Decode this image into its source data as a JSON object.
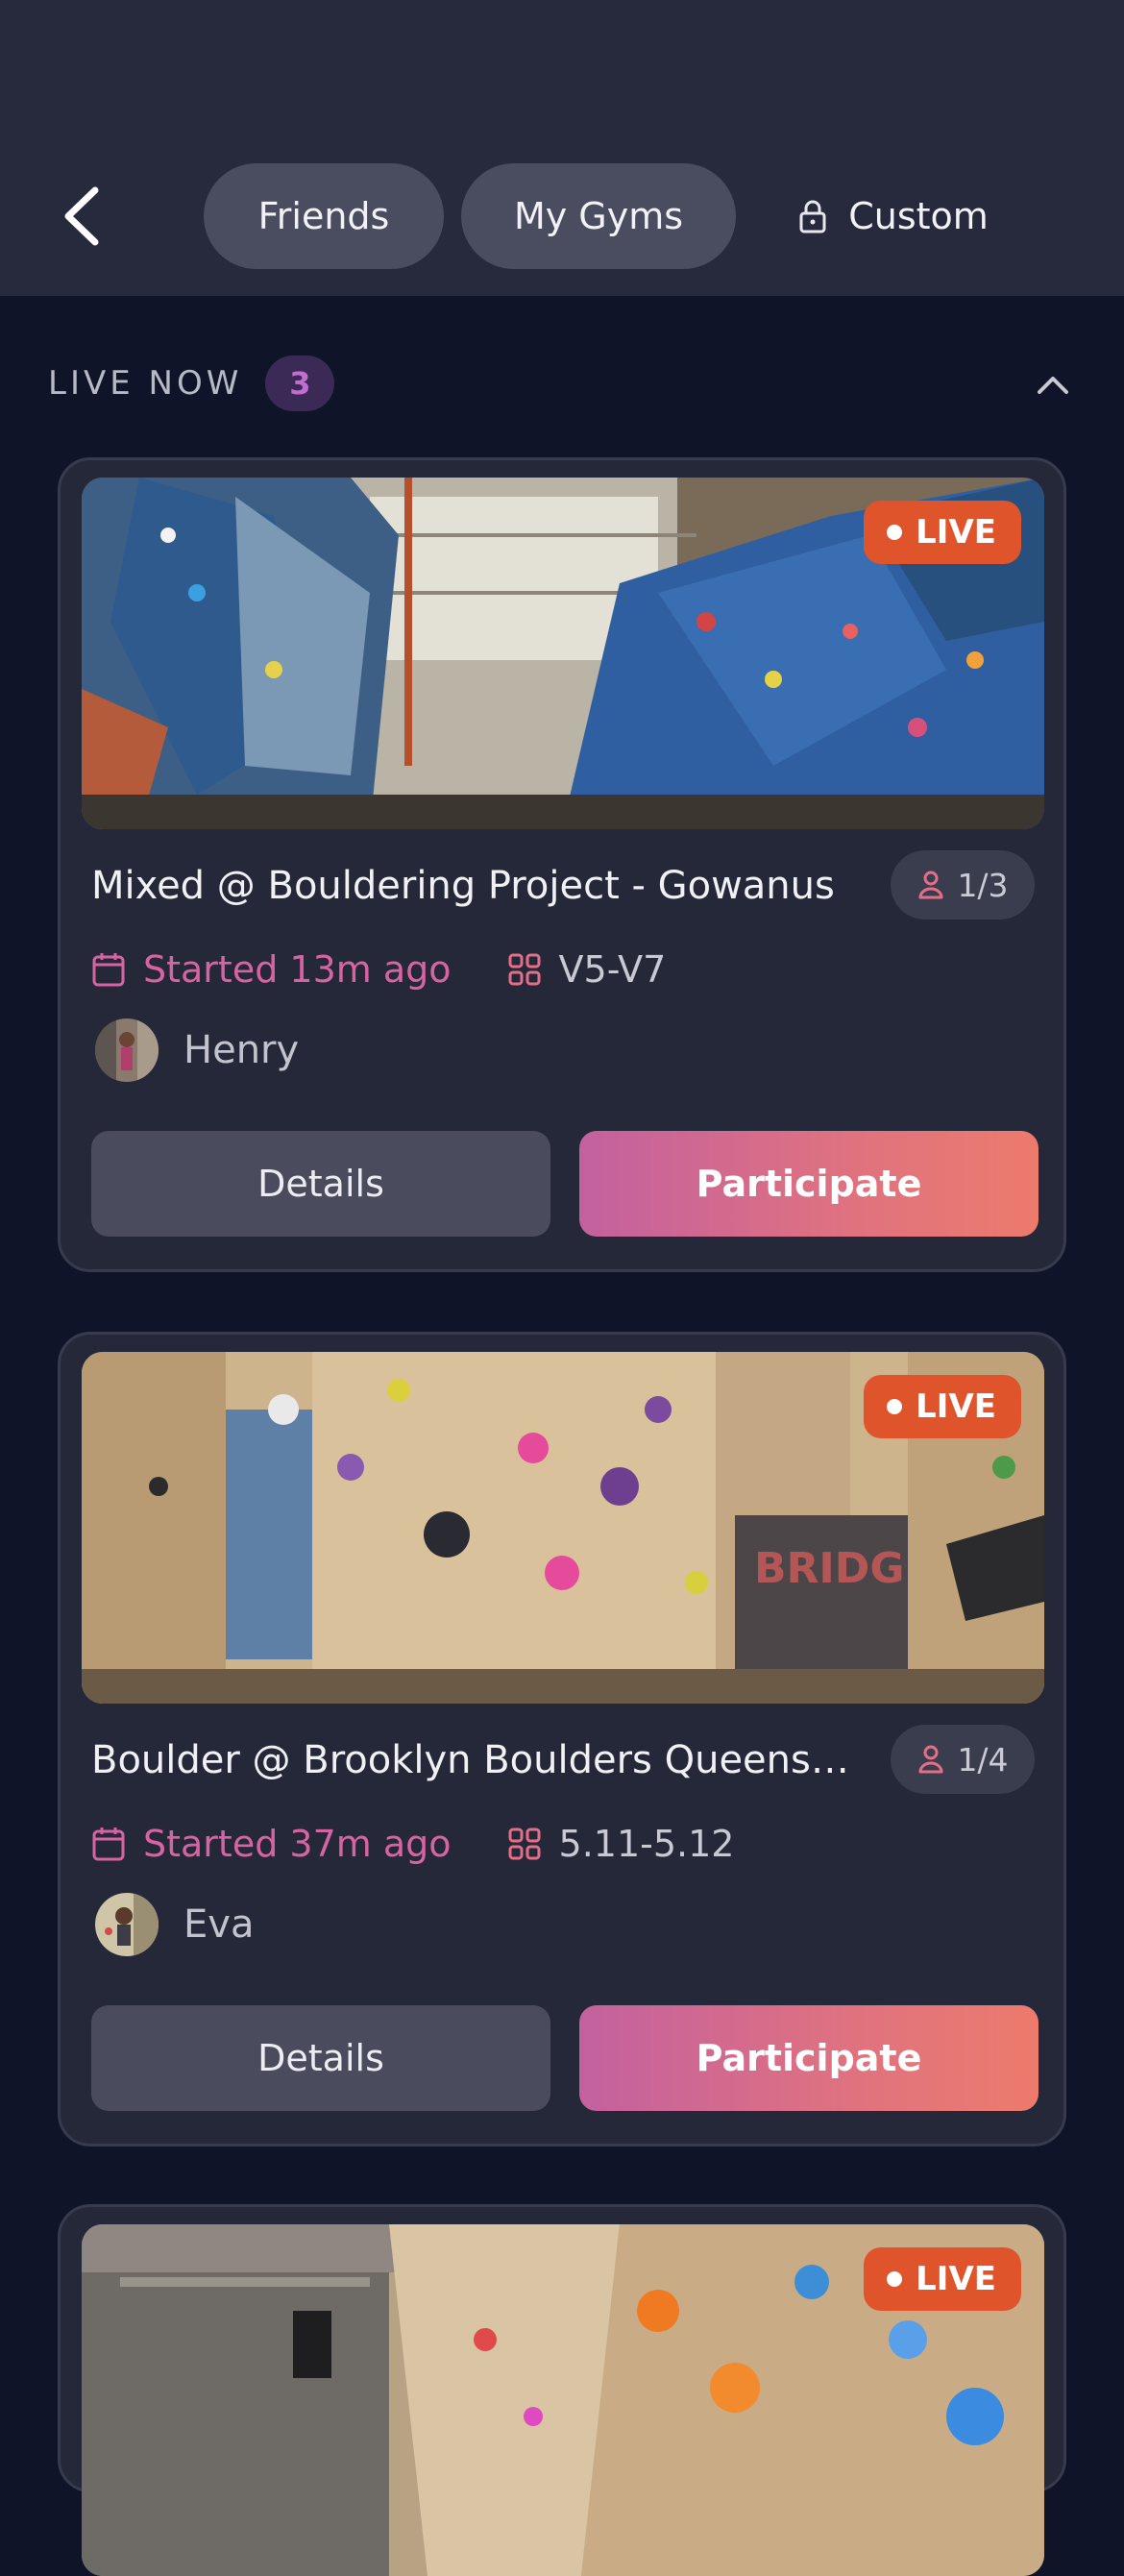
{
  "header": {
    "back_icon": "chevron-left-icon",
    "tabs": [
      {
        "label": "Friends"
      },
      {
        "label": "My Gyms"
      },
      {
        "label": "Custom",
        "icon": "lock-icon"
      }
    ]
  },
  "section": {
    "title": "LIVE NOW",
    "count": "3",
    "collapse_icon": "chevron-up-icon"
  },
  "sessions": [
    {
      "live_label": "LIVE",
      "title": "Mixed @ Bouldering Project - Gowanus",
      "slots": "1/3",
      "started": "Started 13m ago",
      "grade": "V5-V7",
      "host": "Henry",
      "details_label": "Details",
      "participate_label": "Participate"
    },
    {
      "live_label": "LIVE",
      "title": "Boulder @ Brooklyn Boulders Queens…",
      "slots": "1/4",
      "started": "Started 37m ago",
      "grade": "5.11-5.12",
      "host": "Eva",
      "details_label": "Details",
      "participate_label": "Participate"
    },
    {
      "live_label": "LIVE"
    }
  ],
  "colors": {
    "background": "#0f1428",
    "header": "#262a3c",
    "card": "#242838",
    "live": "#e0542c",
    "accent_pink": "#d664a3",
    "participate_from": "#c3619f",
    "participate_to": "#ec7b6c"
  }
}
